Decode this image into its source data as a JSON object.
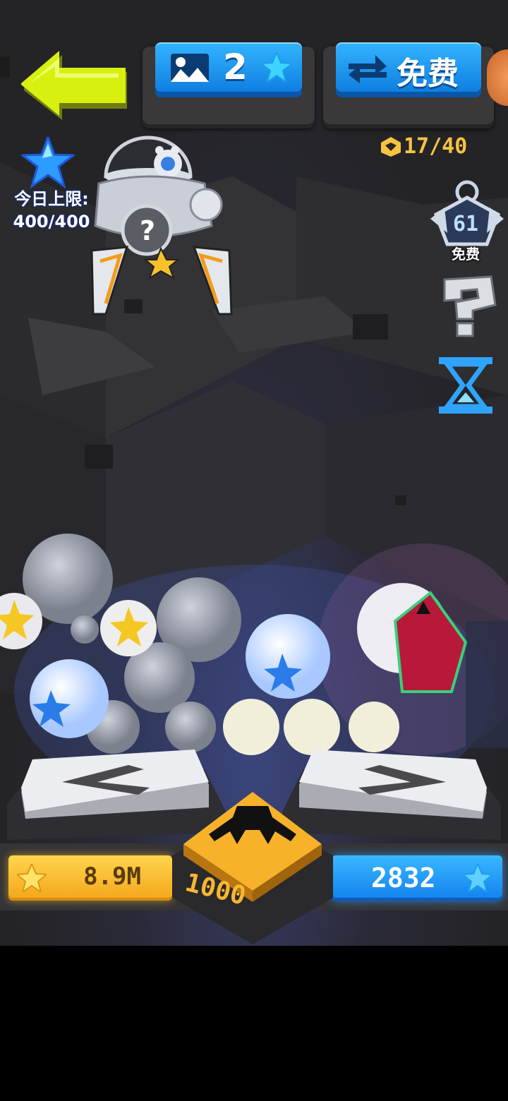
{
  "top_bar": {
    "level_value": "2",
    "free_label": "免费",
    "token_count": "17/40"
  },
  "daily_limit": {
    "label": "今日上限:",
    "value": "400/400"
  },
  "side_buttons": {
    "rank_value": "61",
    "rank_free_label": "免费"
  },
  "bottom": {
    "star_currency": "8.9M",
    "blue_currency": "2832",
    "grab_cost": "1000"
  },
  "icons": [
    "back-arrow-icon",
    "level-map-icon",
    "star-icon",
    "refresh-icon",
    "token-icon",
    "rank-badge-icon",
    "question-icon",
    "hourglass-icon",
    "claw-icon",
    "left-arrow-icon",
    "right-arrow-icon"
  ],
  "colors": {
    "accent_yellow": "#d8f00f",
    "blue": "#1f93f2",
    "gold": "#f6b22a"
  }
}
